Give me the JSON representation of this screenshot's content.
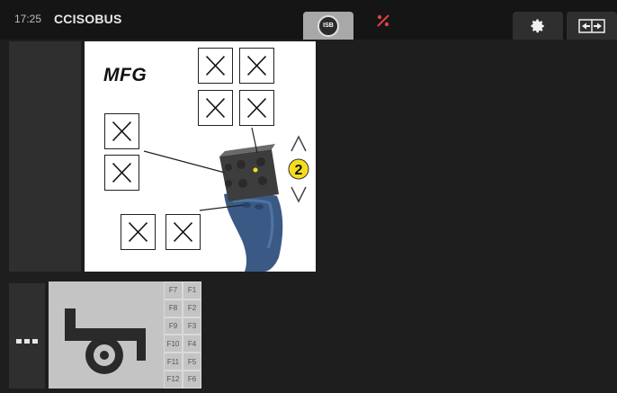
{
  "header": {
    "time": "17:25",
    "brand": "CCISOBUS",
    "isb_label": "ISB"
  },
  "mask": {
    "title": "MFG",
    "level_indicator": "2"
  },
  "function_keys": [
    {
      "left": "F7",
      "right": "F1"
    },
    {
      "left": "F8",
      "right": "F2"
    },
    {
      "left": "F9",
      "right": "F3"
    },
    {
      "left": "F10",
      "right": "F4"
    },
    {
      "left": "F11",
      "right": "F5"
    },
    {
      "left": "F12",
      "right": "F6"
    }
  ],
  "icons": {
    "settings": "gear-icon",
    "switch": "swap-screen-icon",
    "no_link": "link-disconnected-icon",
    "more": "more-icon",
    "implement": "trailer-implement-icon"
  },
  "colors": {
    "yellow_accent": "#f5dd1e",
    "joystick_blue": "#3a5a85"
  }
}
